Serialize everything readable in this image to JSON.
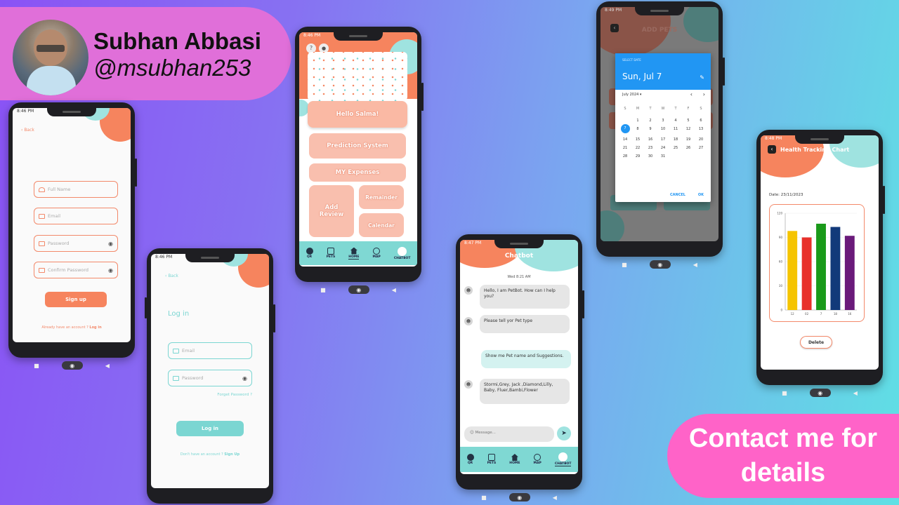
{
  "profile": {
    "name": "Subhan Abbasi",
    "handle": "@msubhan253"
  },
  "cta": {
    "text": "Contact me for details"
  },
  "signup": {
    "time": "8:46 PM",
    "back": "Back",
    "fields": [
      "Full Name",
      "Email",
      "Password",
      "Confirm Password"
    ],
    "button": "Sign up",
    "footer_text": "Already have an account ?",
    "footer_link": "Log in"
  },
  "login": {
    "time": "8:46 PM",
    "back": "Back",
    "title": "Log in",
    "fields": [
      "Email",
      "Password"
    ],
    "forgot": "Forget Password ?",
    "button": "Log in",
    "footer_text": "Don't have an account ?",
    "footer_link": "Sign Up"
  },
  "home": {
    "time": "8:46 PM",
    "greeting": "Hello Salma!",
    "tiles": {
      "prediction": "Prediction System",
      "expenses": "MY Expenses",
      "review": "Add Review",
      "reminder": "Remainder",
      "calendar": "Calendar"
    },
    "nav": [
      "QR",
      "PETS",
      "HOME",
      "MAP",
      "CHATBOT"
    ]
  },
  "chatbot": {
    "time": "8:47 PM",
    "title": "Chatbot",
    "date": "Wed 8:21 AM",
    "messages": [
      {
        "from": "bot",
        "text": "Hello, I am PetBot. How can I help you?"
      },
      {
        "from": "bot",
        "text": "Please tell yor Pet type"
      },
      {
        "from": "user",
        "text": "Show me Pet name and Suggestions."
      },
      {
        "from": "bot",
        "text": "Stormi,Grey, Jack ,Diamond,Lilly, Baby, Fluer,Bambi,Flower"
      }
    ],
    "input_placeholder": "Message...",
    "nav": [
      "QR",
      "PETS",
      "HOME",
      "MAP",
      "CHATBOT"
    ]
  },
  "datepicker": {
    "time": "8:49 PM",
    "screen_title": "ADD PETS",
    "header_label": "SELECT DATE",
    "selected": "Sun, Jul 7",
    "month": "July 2024",
    "weekdays": [
      "S",
      "M",
      "T",
      "W",
      "T",
      "F",
      "S"
    ],
    "days": [
      "1",
      "2",
      "3",
      "4",
      "5",
      "6",
      "7",
      "8",
      "9",
      "10",
      "11",
      "12",
      "13",
      "14",
      "15",
      "16",
      "17",
      "18",
      "19",
      "20",
      "21",
      "22",
      "23",
      "24",
      "25",
      "26",
      "27",
      "28",
      "29",
      "30",
      "31"
    ],
    "selected_day": "7",
    "cancel": "CANCEL",
    "ok": "OK"
  },
  "health": {
    "time": "8:48 PM",
    "title": "Health Tracking Chart",
    "date": "Date: 23/11/2023",
    "delete": "Delete"
  },
  "chart_data": {
    "type": "bar",
    "categories": [
      "12",
      "02",
      "7",
      "18",
      "16"
    ],
    "values": [
      98,
      90,
      107,
      103,
      92
    ],
    "colors": [
      "#f5c400",
      "#e8302a",
      "#1a9a1a",
      "#123a7a",
      "#6a1a7a"
    ],
    "yticks": [
      "0",
      "30",
      "60",
      "90",
      "120"
    ],
    "ylim": [
      0,
      120
    ]
  }
}
